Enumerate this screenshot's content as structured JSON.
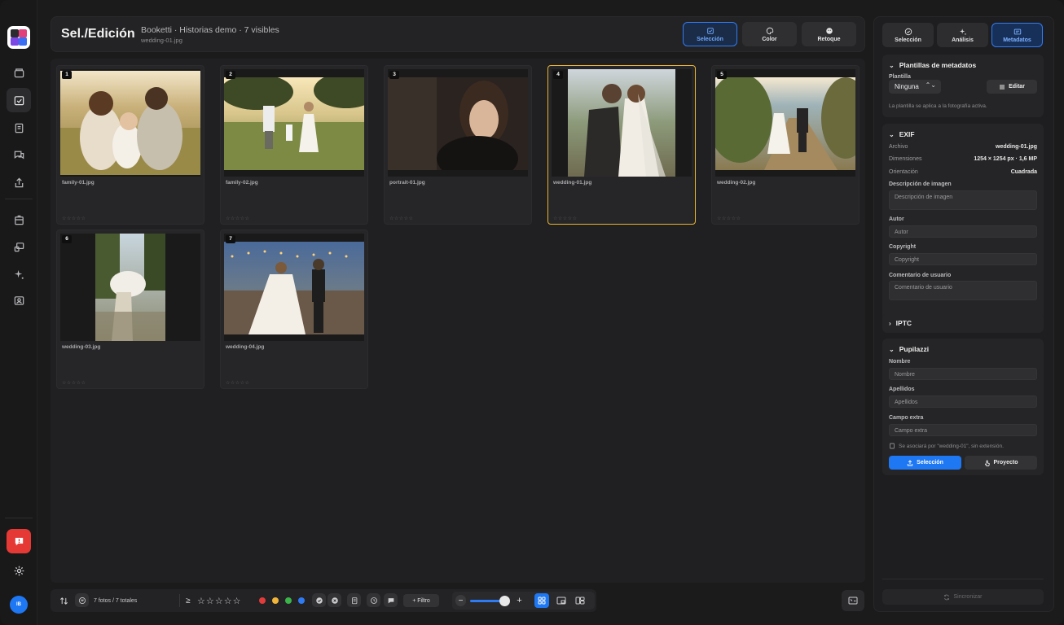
{
  "app": {
    "title": "Sel./Edición",
    "project": "Booketti · Historias demo · 7 visibles",
    "current_file": "wedding-01.jpg"
  },
  "modes": [
    {
      "label": "Selección",
      "icon": "selection-icon",
      "active": true
    },
    {
      "label": "Color",
      "icon": "palette-icon",
      "active": false
    },
    {
      "label": "Retoque",
      "icon": "retouch-icon",
      "active": false
    }
  ],
  "photos": [
    {
      "num": "1",
      "file": "family-01.jpg",
      "stars": "☆☆☆☆☆",
      "selected": false
    },
    {
      "num": "2",
      "file": "family-02.jpg",
      "stars": "☆☆☆☆☆",
      "selected": false
    },
    {
      "num": "3",
      "file": "portrait-01.jpg",
      "stars": "☆☆☆☆☆",
      "selected": false
    },
    {
      "num": "4",
      "file": "wedding-01.jpg",
      "stars": "☆☆☆☆☆",
      "selected": true
    },
    {
      "num": "5",
      "file": "wedding-02.jpg",
      "stars": "☆☆☆☆☆",
      "selected": false
    },
    {
      "num": "6",
      "file": "wedding-03.jpg",
      "stars": "☆☆☆☆☆",
      "selected": false
    },
    {
      "num": "7",
      "file": "wedding-04.jpg",
      "stars": "☆☆☆☆☆",
      "selected": false
    }
  ],
  "toolbar": {
    "count_text": "7 fotos / 7 totales",
    "rating_op": "≥",
    "rating_stars": "☆ ☆ ☆ ☆ ☆",
    "color_dots": [
      "#e23b3b",
      "#f1b53a",
      "#3bb44a",
      "#2f7bf4"
    ],
    "filter_label": "+ Filtro",
    "zoom_minus": "−",
    "zoom_plus": "+",
    "zoom_level": 0.75
  },
  "inspector": {
    "tabs": [
      {
        "label": "Selección",
        "icon": "check-circle-icon",
        "active": false
      },
      {
        "label": "Análisis",
        "icon": "sparkle-icon",
        "active": false
      },
      {
        "label": "Metadatos",
        "icon": "id-card-icon",
        "active": true
      }
    ],
    "templates": {
      "title": "Plantillas de metadatos",
      "label": "Plantilla",
      "selected": "Ninguna",
      "arrows": "⌃⌄",
      "edit_label": "Editar",
      "note": "La plantilla se aplica a la fotografía activa."
    },
    "exif": {
      "title": "EXIF",
      "rows": [
        {
          "key": "Archivo",
          "value": "wedding-01.jpg"
        },
        {
          "key": "Dimensiones",
          "value": "1254 × 1254 px · 1,6 MP"
        },
        {
          "key": "Orientación",
          "value": "Cuadrada"
        }
      ],
      "fields": [
        {
          "label": "Descripción de imagen",
          "placeholder": "Descripción de imagen"
        },
        {
          "label": "Autor",
          "placeholder": "Autor"
        },
        {
          "label": "Copyright",
          "placeholder": "Copyright"
        },
        {
          "label": "Comentario de usuario",
          "placeholder": "Comentario de usuario"
        }
      ]
    },
    "iptc": {
      "title": "IPTC"
    },
    "pupilazzi": {
      "title": "Pupilazzi",
      "fields": [
        {
          "label": "Nombre",
          "placeholder": "Nombre"
        },
        {
          "label": "Apellidos",
          "placeholder": "Apellidos"
        },
        {
          "label": "Campo extra",
          "placeholder": "Campo extra"
        }
      ],
      "note": "Se asociará por \"wedding-01\", sin extensión.",
      "btn_selection": "Selección",
      "btn_project": "Proyecto"
    },
    "sync_label": "Sincronizar"
  },
  "user": {
    "initials": "IB"
  }
}
